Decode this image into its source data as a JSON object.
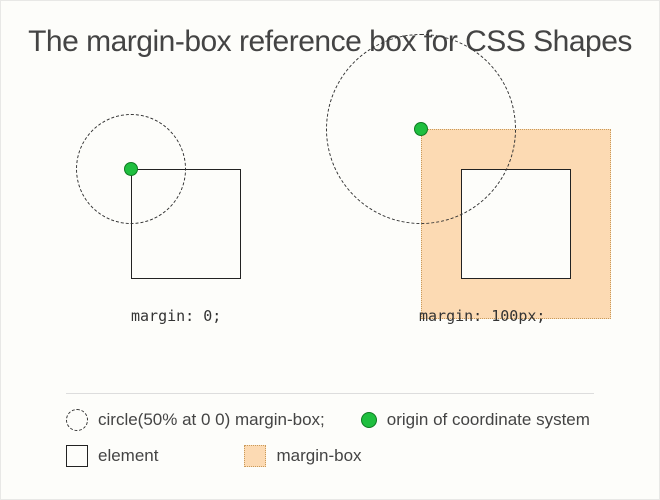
{
  "title": "The margin-box reference box for CSS Shapes",
  "examples": {
    "left": {
      "caption": "margin: 0;"
    },
    "right": {
      "caption": "margin: 100px;"
    }
  },
  "legend": {
    "circle": "circle(50% at 0 0) margin-box;",
    "origin": "origin of coordinate system",
    "element": "element",
    "marginbox": "margin-box"
  },
  "colors": {
    "accent_green": "#1fbf3f",
    "margin_fill": "#fcdab3"
  }
}
